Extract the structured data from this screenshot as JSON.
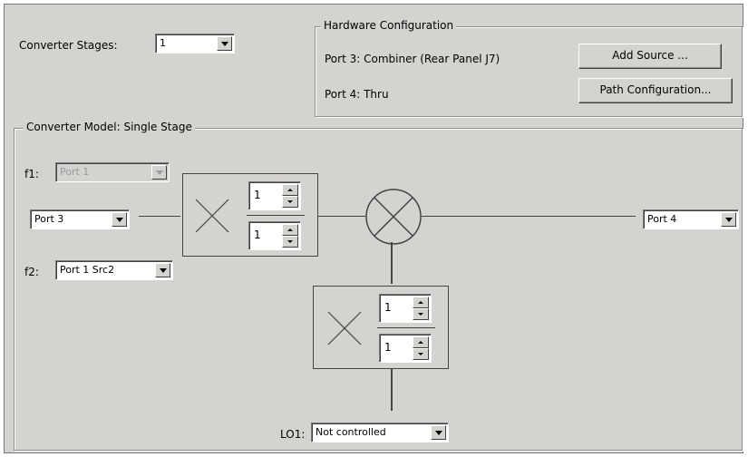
{
  "converter_stages": {
    "label": "Converter Stages:",
    "value": "1"
  },
  "hardware": {
    "title": "Hardware Configuration",
    "port3_text": "Port 3: Combiner (Rear Panel J7)",
    "port4_text": "Port 4: Thru",
    "add_source": "Add Source ...",
    "path_config": "Path Configuration..."
  },
  "model": {
    "title": "Converter Model: Single Stage",
    "f1_label": "f1:",
    "f1_value": "Port 1",
    "input_port": "Port 3",
    "f2_label": "f2:",
    "f2_value": "Port 1 Src2",
    "output_port": "Port 4",
    "stage1_multiplier": {
      "num": "1",
      "den": "1"
    },
    "lo_multiplier": {
      "num": "1",
      "den": "1"
    },
    "lo1_label": "LO1:",
    "lo1_value": "Not controlled"
  },
  "colors": {
    "panel_bg": "#d5d3cf",
    "line": "#444444",
    "disabled_text": "#9a9a9a"
  },
  "icons": [
    "multiplier-x-icon",
    "mixer-icon",
    "dropdown-arrow-icon",
    "spin-up-icon",
    "spin-down-icon"
  ]
}
